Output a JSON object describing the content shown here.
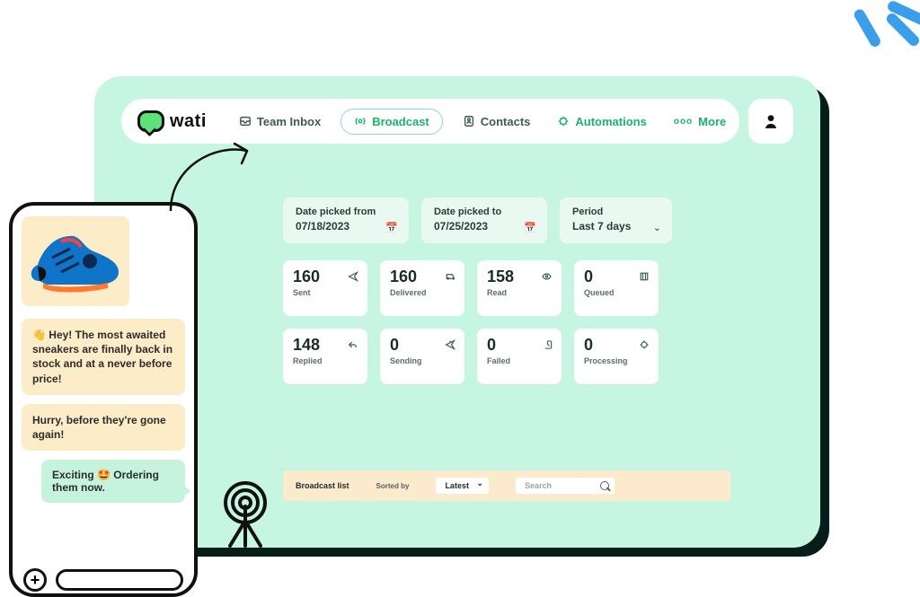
{
  "brand": {
    "name": "wati"
  },
  "nav": {
    "teamInbox": "Team Inbox",
    "broadcast": "Broadcast",
    "contacts": "Contacts",
    "automations": "Automations",
    "moreGlyph": "ooo",
    "more": "More"
  },
  "filters": {
    "fromLabel": "Date picked from",
    "fromValue": "07/18/2023",
    "toLabel": "Date picked to",
    "toValue": "07/25/2023",
    "periodLabel": "Period",
    "periodValue": "Last 7 days"
  },
  "stats": {
    "sent": {
      "value": "160",
      "label": "Sent"
    },
    "delivered": {
      "value": "160",
      "label": "Delivered"
    },
    "read": {
      "value": "158",
      "label": "Read"
    },
    "queued": {
      "value": "0",
      "label": "Queued"
    },
    "replied": {
      "value": "148",
      "label": "Replied"
    },
    "sending": {
      "value": "0",
      "label": "Sending"
    },
    "failed": {
      "value": "0",
      "label": "Failed"
    },
    "processing": {
      "value": "0",
      "label": "Processing"
    }
  },
  "broadcastList": {
    "title": "Broadcast list",
    "sortedBy": "Sorted by",
    "sortValue": "Latest",
    "searchPlaceholder": "Search"
  },
  "chat": {
    "msg1": "👋 Hey! The most awaited sneakers are finally back in stock and at a never before price!",
    "msg2": "Hurry, before they're gone again!",
    "reply": "Exciting 🤩 Ordering them now."
  }
}
